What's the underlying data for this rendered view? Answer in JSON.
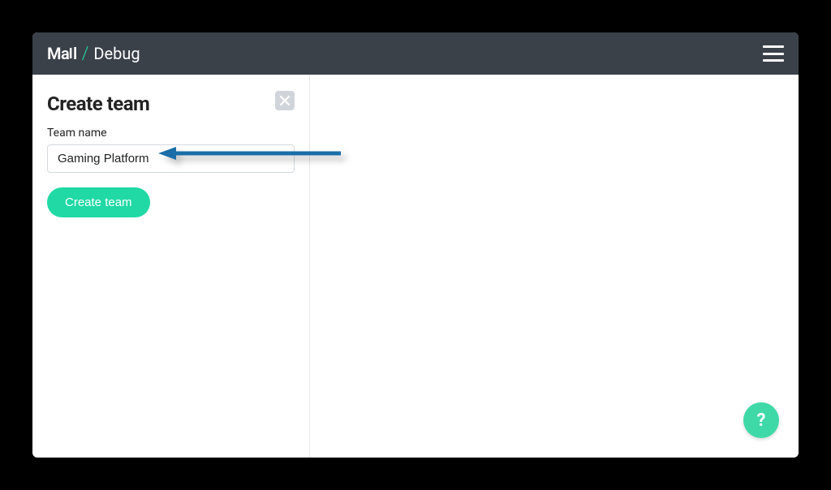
{
  "brand": {
    "mail": "MaIl",
    "debug": "Debug"
  },
  "panel": {
    "title": "Create team",
    "field_label": "Team name",
    "team_name_value": "Gaming Platform",
    "submit_label": "Create team"
  },
  "help": {
    "label": "?"
  },
  "colors": {
    "accent": "#20d9a5",
    "header_bg": "#3a4149",
    "arrow": "#1b6ea8"
  }
}
